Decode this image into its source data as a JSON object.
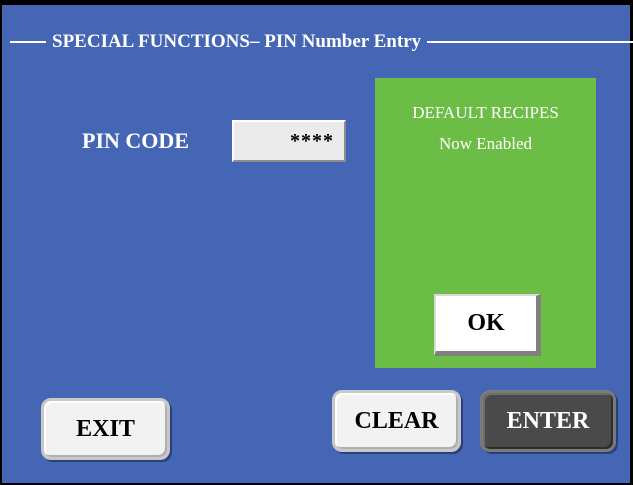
{
  "header": {
    "title": "SPECIAL FUNCTIONS– PIN Number Entry"
  },
  "pin": {
    "label": "PIN CODE",
    "value": "****"
  },
  "message": {
    "line1": "DEFAULT RECIPES",
    "line2": "Now Enabled",
    "ok_label": "OK"
  },
  "buttons": {
    "exit": "EXIT",
    "clear": "CLEAR",
    "enter": "ENTER"
  },
  "colors": {
    "background": "#4466b5",
    "message_panel": "#6bbd45",
    "enter_button": "#4a4a4a"
  }
}
